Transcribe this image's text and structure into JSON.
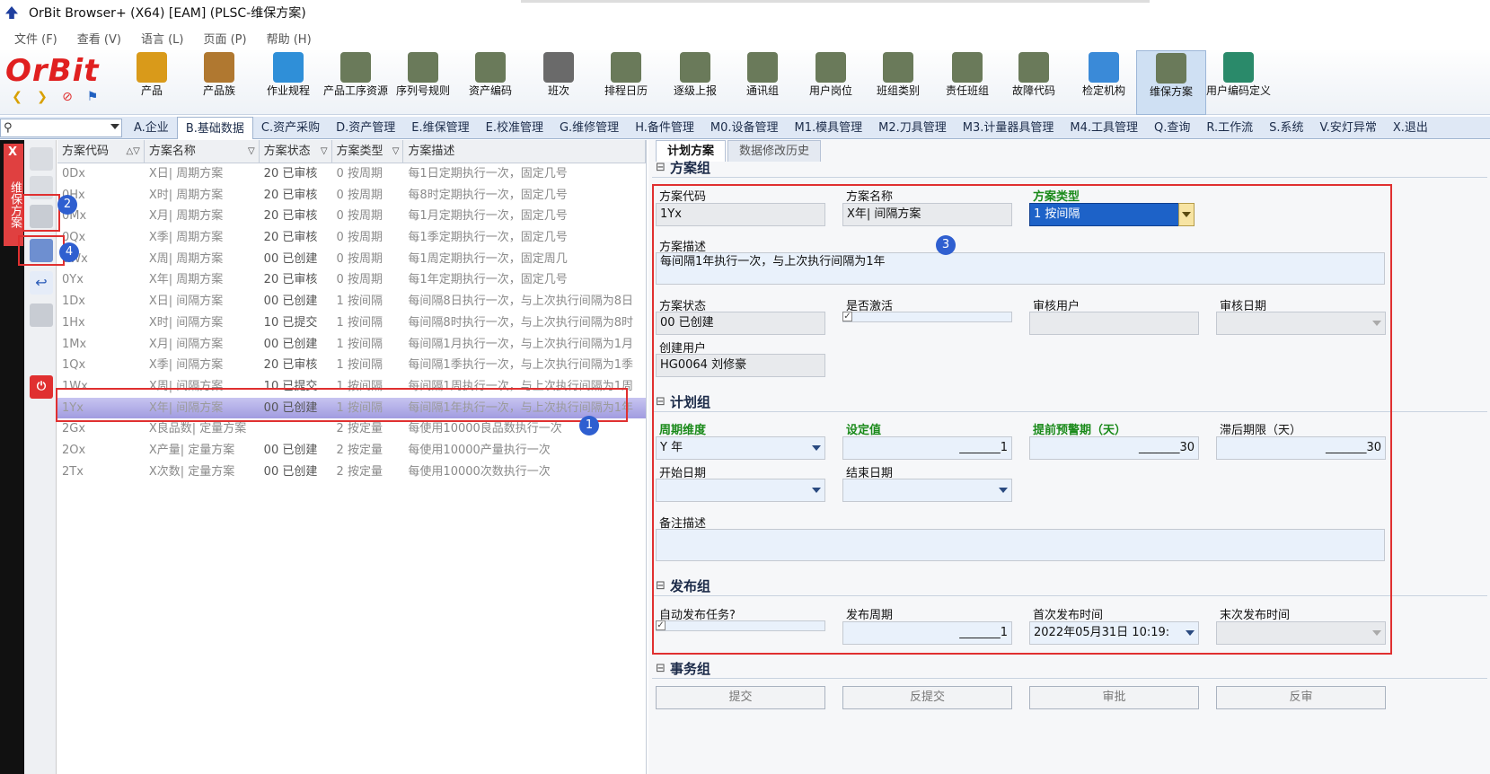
{
  "window": {
    "title": "OrBit Browser+ (X64) [EAM] (PLSC-维保方案)"
  },
  "menu": [
    "文件 (F)",
    "查看 (V)",
    "语言 (L)",
    "页面 (P)",
    "帮助 (H)"
  ],
  "logo": {
    "text": "OrBit"
  },
  "toolbar": [
    {
      "label": "产品"
    },
    {
      "label": "产品族"
    },
    {
      "label": "作业规程"
    },
    {
      "label": "产品工序资源"
    },
    {
      "label": "序列号规则"
    },
    {
      "label": "资产编码"
    },
    {
      "label": "班次"
    },
    {
      "label": "排程日历"
    },
    {
      "label": "逐级上报"
    },
    {
      "label": "通讯组"
    },
    {
      "label": "用户岗位"
    },
    {
      "label": "班组类别"
    },
    {
      "label": "责任班组"
    },
    {
      "label": "故障代码"
    },
    {
      "label": "检定机构"
    },
    {
      "label": "维保方案"
    },
    {
      "label": "用户编码定义"
    }
  ],
  "tabs": [
    "A.企业",
    "B.基础数据",
    "C.资产采购",
    "D.资产管理",
    "E.维保管理",
    "E.校准管理",
    "G.维修管理",
    "H.备件管理",
    "M0.设备管理",
    "M1.模具管理",
    "M2.刀具管理",
    "M3.计量器具管理",
    "M4.工具管理",
    "Q.查询",
    "R.工作流",
    "S.系统",
    "V.安灯异常",
    "X.退出"
  ],
  "side_label": "维保方案",
  "side_close": "X",
  "grid": {
    "headers": [
      "方案代码",
      "方案名称",
      "方案状态",
      "方案类型",
      "方案描述"
    ],
    "rows": [
      {
        "code": "0Dx",
        "name": "X日| 周期方案",
        "status": "20 已审核",
        "type": "0 按周期",
        "desc": "每1日定期执行一次，固定几号"
      },
      {
        "code": "0Hx",
        "name": "X时| 周期方案",
        "status": "20 已审核",
        "type": "0 按周期",
        "desc": "每8时定期执行一次，固定几号"
      },
      {
        "code": "0Mx",
        "name": "X月| 周期方案",
        "status": "20 已审核",
        "type": "0 按周期",
        "desc": "每1月定期执行一次，固定几号"
      },
      {
        "code": "0Qx",
        "name": "X季| 周期方案",
        "status": "20 已审核",
        "type": "0 按周期",
        "desc": "每1季定期执行一次，固定几号"
      },
      {
        "code": "0Wx",
        "name": "X周| 周期方案",
        "status": "00 已创建",
        "type": "0 按周期",
        "desc": "每1周定期执行一次，固定周几"
      },
      {
        "code": "0Yx",
        "name": "X年| 周期方案",
        "status": "20 已审核",
        "type": "0 按周期",
        "desc": "每1年定期执行一次，固定几号"
      },
      {
        "code": "1Dx",
        "name": "X日| 间隔方案",
        "status": "00 已创建",
        "type": "1 按间隔",
        "desc": "每间隔8日执行一次，与上次执行间隔为8日"
      },
      {
        "code": "1Hx",
        "name": "X时| 间隔方案",
        "status": "10 已提交",
        "type": "1 按间隔",
        "desc": "每间隔8时执行一次，与上次执行间隔为8时"
      },
      {
        "code": "1Mx",
        "name": "X月| 间隔方案",
        "status": "00 已创建",
        "type": "1 按间隔",
        "desc": "每间隔1月执行一次，与上次执行间隔为1月"
      },
      {
        "code": "1Qx",
        "name": "X季| 间隔方案",
        "status": "20 已审核",
        "type": "1 按间隔",
        "desc": "每间隔1季执行一次，与上次执行间隔为1季"
      },
      {
        "code": "1Wx",
        "name": "X周| 间隔方案",
        "status": "10 已提交",
        "type": "1 按间隔",
        "desc": "每间隔1周执行一次，与上次执行间隔为1周"
      },
      {
        "code": "1Yx",
        "name": "X年| 间隔方案",
        "status": "00 已创建",
        "type": "1 按间隔",
        "desc": "每间隔1年执行一次，与上次执行间隔为1年"
      },
      {
        "code": "2Gx",
        "name": "X良品数| 定量方案",
        "status": "",
        "type": "2 按定量",
        "desc": "每使用10000良品数执行一次"
      },
      {
        "code": "2Ox",
        "name": "X产量| 定量方案",
        "status": "00 已创建",
        "type": "2 按定量",
        "desc": "每使用10000产量执行一次"
      },
      {
        "code": "2Tx",
        "name": "X次数| 定量方案",
        "status": "00 已创建",
        "type": "2 按定量",
        "desc": "每使用10000次数执行一次"
      }
    ]
  },
  "right_tabs": [
    "计划方案",
    "数据修改历史"
  ],
  "groups": {
    "plan_group": "方案组",
    "schedule_group": "计划组",
    "publish_group": "发布组",
    "action_group": "事务组"
  },
  "form": {
    "code_label": "方案代码",
    "code_value": "1Yx",
    "name_label": "方案名称",
    "name_value": "X年| 间隔方案",
    "type_label": "方案类型",
    "type_value": "1 按间隔",
    "desc_label": "方案描述",
    "desc_value": "每间隔1年执行一次，与上次执行间隔为1年",
    "status_label": "方案状态",
    "status_value": "00 已创建",
    "active_label": "是否激活",
    "reviewer_label": "审核用户",
    "review_date_label": "审核日期",
    "creator_label": "创建用户",
    "creator_value": "HG0064 刘修豪",
    "period_label": "周期维度",
    "period_value": "Y 年",
    "set_label": "设定值",
    "set_value": "_______1",
    "warn_label": "提前预警期（天）",
    "warn_value": "_______30",
    "lag_label": "滞后期限（天）",
    "lag_value": "_______30",
    "start_label": "开始日期",
    "end_label": "结束日期",
    "remark_label": "备注描述",
    "auto_label": "自动发布任务?",
    "pub_cycle_label": "发布周期",
    "pub_cycle_value": "_______1",
    "first_pub_label": "首次发布时间",
    "first_pub_value": "2022年05月31日 10:19:",
    "last_pub_label": "末次发布时间"
  },
  "actions": [
    "提交",
    "反提交",
    "审批",
    "反审"
  ],
  "badges": [
    "1",
    "2",
    "3",
    "4"
  ],
  "colors": {
    "accent": "#1d62c8",
    "highlight": "#e03030",
    "badge": "#2f5fd0",
    "required_label": "#1a8a1a"
  }
}
